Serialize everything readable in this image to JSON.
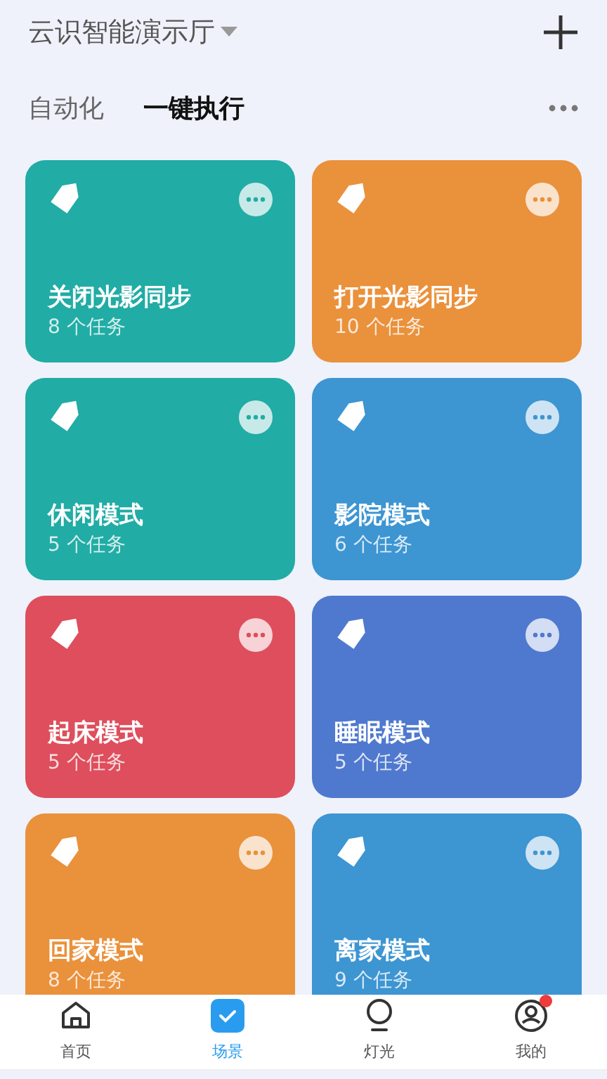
{
  "header": {
    "title": "云识智能演示厅"
  },
  "tabs": [
    {
      "label": "自动化",
      "selected": false
    },
    {
      "label": "一键执行",
      "selected": true
    }
  ],
  "scenes": [
    {
      "name": "关闭光影同步",
      "tasks": "8 个任务",
      "color": "#21aca5"
    },
    {
      "name": "打开光影同步",
      "tasks": "10 个任务",
      "color": "#ea913b"
    },
    {
      "name": "休闲模式",
      "tasks": "5 个任务",
      "color": "#21aca5"
    },
    {
      "name": "影院模式",
      "tasks": "6 个任务",
      "color": "#3d95d2"
    },
    {
      "name": "起床模式",
      "tasks": "5 个任务",
      "color": "#de4e5c"
    },
    {
      "name": "睡眠模式",
      "tasks": "5 个任务",
      "color": "#4f79cf"
    },
    {
      "name": "回家模式",
      "tasks": "8 个任务",
      "color": "#ea913b"
    },
    {
      "name": "离家模式",
      "tasks": "9 个任务",
      "color": "#3d95d2"
    }
  ],
  "nav": [
    {
      "kind": "home",
      "label": "首页",
      "selected": false,
      "badge": false
    },
    {
      "kind": "scene",
      "label": "场景",
      "selected": true,
      "badge": false
    },
    {
      "kind": "light",
      "label": "灯光",
      "selected": false,
      "badge": false
    },
    {
      "kind": "me",
      "label": "我的",
      "selected": false,
      "badge": true
    }
  ]
}
